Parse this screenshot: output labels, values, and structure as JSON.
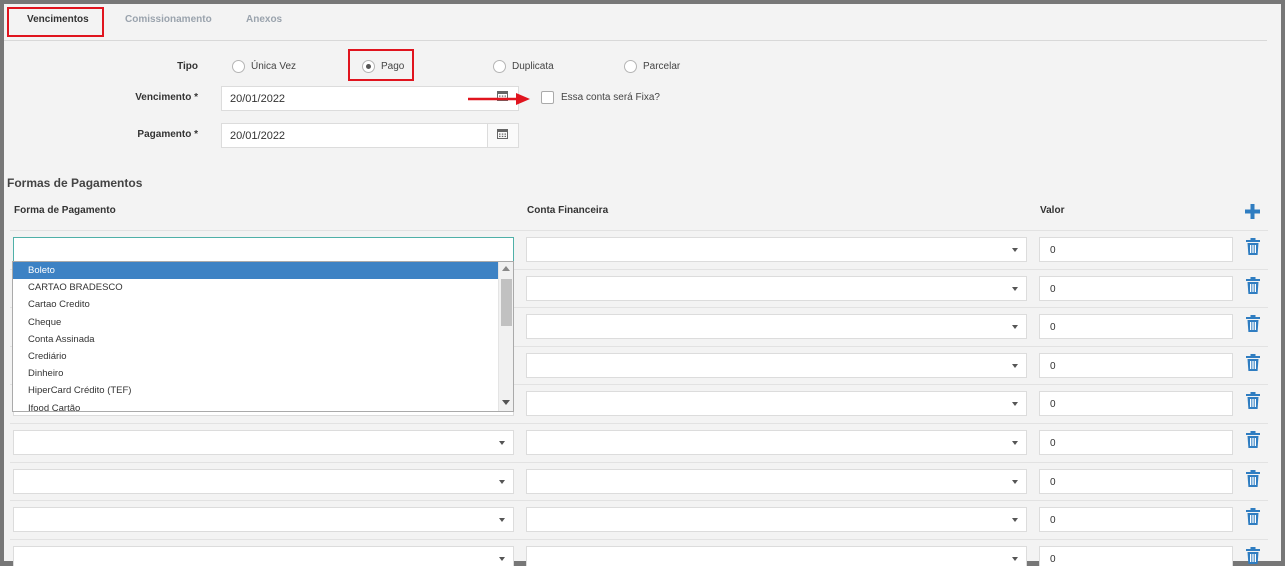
{
  "tabs": [
    {
      "label": "Vencimentos",
      "active": true
    },
    {
      "label": "Comissionamento",
      "active": false
    },
    {
      "label": "Anexos",
      "active": false
    }
  ],
  "tipo": {
    "label": "Tipo",
    "options": [
      "Única Vez",
      "Pago",
      "Duplicata",
      "Parcelar"
    ],
    "selected": "Pago"
  },
  "vencimento": {
    "label": "Vencimento *",
    "value": "20/01/2022"
  },
  "fixa": {
    "label": "Essa conta será Fixa?"
  },
  "pagamento": {
    "label": "Pagamento *",
    "value": "20/01/2022"
  },
  "formas": {
    "title": "Formas de Pagamentos",
    "columns": {
      "forma": "Forma de Pagamento",
      "conta": "Conta Financeira",
      "valor": "Valor"
    },
    "rows": [
      {
        "forma": "",
        "conta": "",
        "valor": "0"
      },
      {
        "forma": "",
        "conta": "",
        "valor": "0"
      },
      {
        "forma": "",
        "conta": "",
        "valor": "0"
      },
      {
        "forma": "",
        "conta": "",
        "valor": "0"
      },
      {
        "forma": "",
        "conta": "",
        "valor": "0"
      },
      {
        "forma": "",
        "conta": "",
        "valor": "0"
      },
      {
        "forma": "",
        "conta": "",
        "valor": "0"
      },
      {
        "forma": "",
        "conta": "",
        "valor": "0"
      },
      {
        "forma": "",
        "conta": "",
        "valor": "0"
      }
    ],
    "dropdown_options": [
      "Boleto",
      "CARTAO BRADESCO",
      "Cartao Credito",
      "Cheque",
      "Conta Assinada",
      "Crediário",
      "Dinheiro",
      "HiperCard Crédito (TEF)",
      "Ifood Cartão"
    ],
    "dropdown_highlighted": "Boleto"
  },
  "colors": {
    "accent": "#2f7dc1",
    "highlight": "#3d82c4",
    "annotation": "#e0141e",
    "focus": "#4fb0a8"
  },
  "icons": {
    "add": "plus-icon",
    "delete": "trash-icon",
    "calendar": "calendar-icon"
  }
}
